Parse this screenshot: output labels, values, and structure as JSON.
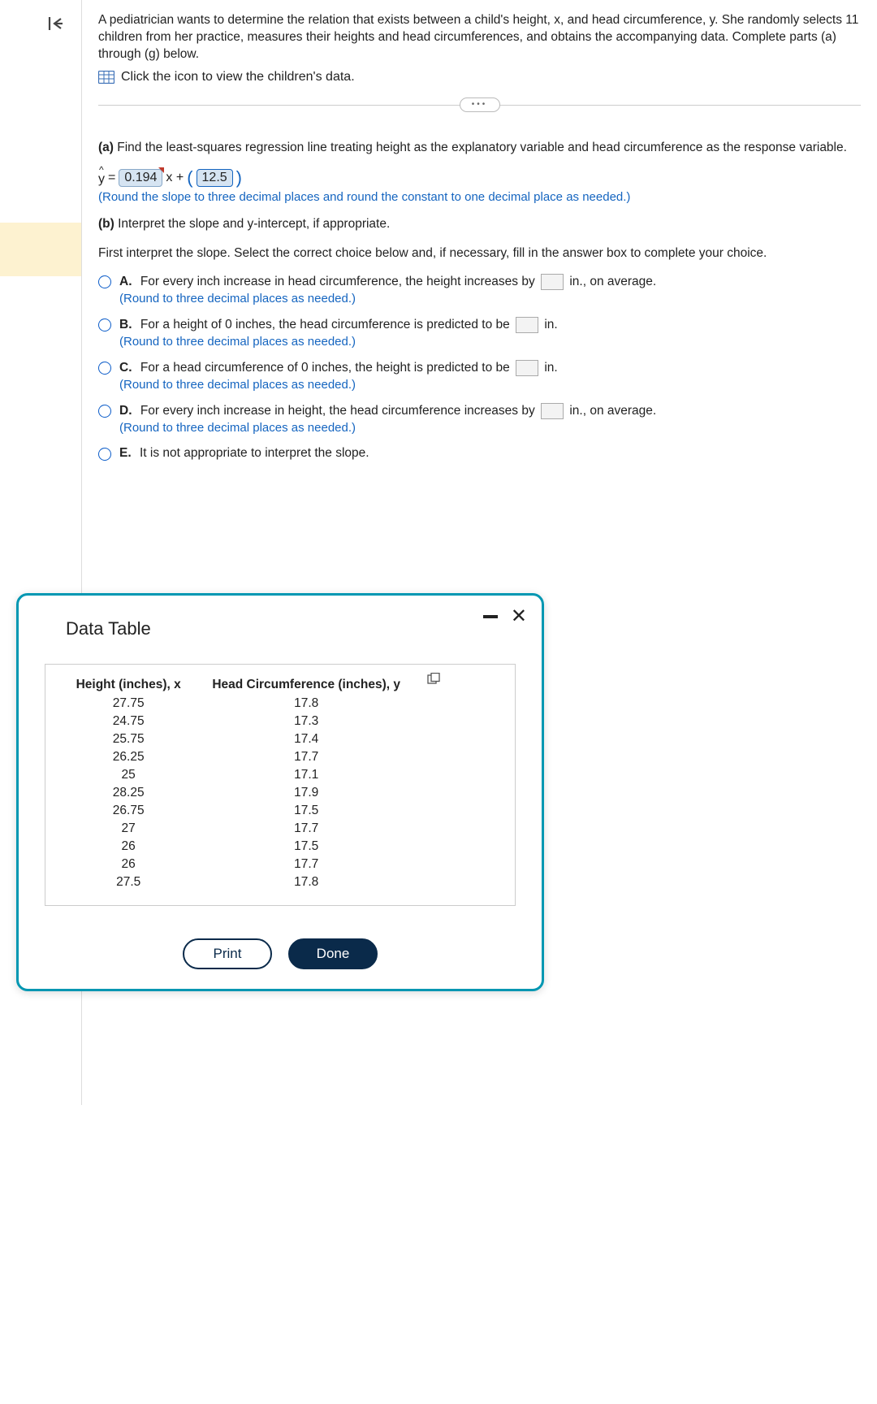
{
  "problem": {
    "text": "A pediatrician wants to determine the relation that exists between a child's height, x, and head circumference, y. She randomly selects 11 children from her practice, measures their heights and head circumferences, and obtains the accompanying data. Complete parts (a) through (g) below.",
    "data_link": "Click the icon to view the children's data."
  },
  "part_a": {
    "prefix": "(a)",
    "text": "Find the least-squares regression line treating height as the explanatory variable and head circumference as the response variable.",
    "eq_y": "y",
    "eq_eq": " = ",
    "slope": "0.194",
    "x_plus": "x + ",
    "open_paren": "(",
    "intercept": "12.5",
    "close_paren": ")",
    "round_note": "(Round the slope to three decimal places and round the constant to one decimal place as needed.)"
  },
  "part_b": {
    "prefix": "(b)",
    "text": "Interpret the slope and y-intercept, if appropriate.",
    "instruction": "First interpret the slope. Select the correct choice below and, if necessary, fill in the answer box to complete your choice."
  },
  "choices": {
    "A": {
      "letter": "A.",
      "before": "For every inch increase in head circumference, the height increases by ",
      "after": " in., on average.",
      "round": "(Round to three decimal places as needed.)"
    },
    "B": {
      "letter": "B.",
      "before": "For a height of 0 inches, the head circumference is predicted to be ",
      "after": " in.",
      "round": "(Round to three decimal places as needed.)"
    },
    "C": {
      "letter": "C.",
      "before": "For a head circumference of 0 inches, the height is predicted to be ",
      "after": " in.",
      "round": "(Round to three decimal places as needed.)"
    },
    "D": {
      "letter": "D.",
      "before": "For every inch increase in height, the head circumference increases by ",
      "after": " in., on average.",
      "round": "(Round to three decimal places as needed.)"
    },
    "E": {
      "letter": "E.",
      "text": "It is not appropriate to interpret the slope."
    }
  },
  "modal": {
    "title": "Data Table",
    "col1": "Height (inches), x",
    "col2": "Head Circumference (inches), y",
    "rows": [
      {
        "x": "27.75",
        "y": "17.8"
      },
      {
        "x": "24.75",
        "y": "17.3"
      },
      {
        "x": "25.75",
        "y": "17.4"
      },
      {
        "x": "26.25",
        "y": "17.7"
      },
      {
        "x": "25",
        "y": "17.1"
      },
      {
        "x": "28.25",
        "y": "17.9"
      },
      {
        "x": "26.75",
        "y": "17.5"
      },
      {
        "x": "27",
        "y": "17.7"
      },
      {
        "x": "26",
        "y": "17.5"
      },
      {
        "x": "26",
        "y": "17.7"
      },
      {
        "x": "27.5",
        "y": "17.8"
      }
    ],
    "print": "Print",
    "done": "Done"
  },
  "expand_dots": "•••"
}
